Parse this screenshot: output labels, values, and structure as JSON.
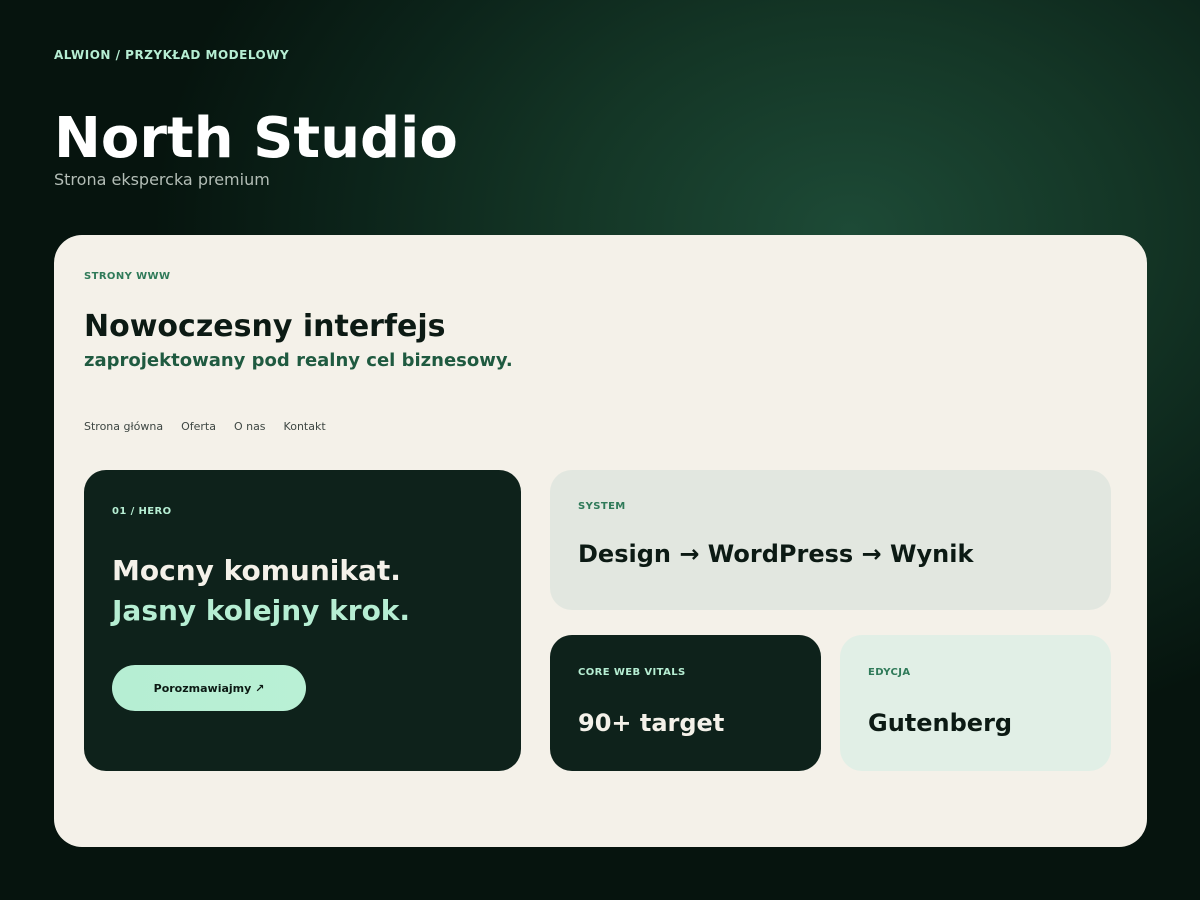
{
  "header": {
    "breadcrumb": "ALWION / PRZYKŁAD MODELOWY",
    "title": "North Studio",
    "subtitle": "Strona ekspercka premium"
  },
  "card": {
    "eyebrow": "STRONY WWW",
    "headline": "Nowoczesny interfejs",
    "subheadline": "zaprojektowany pod realny cel biznesowy.",
    "nav": [
      "Strona główna",
      "Oferta",
      "O nas",
      "Kontakt"
    ]
  },
  "hero": {
    "label": "01 / HERO",
    "line1": "Mocny komunikat.",
    "line2": "Jasny kolejny krok.",
    "cta_label": "Porozmawiajmy ↗"
  },
  "system": {
    "label": "SYSTEM",
    "text": "Design → WordPress → Wynik"
  },
  "core_web_vitals": {
    "label": "CORE WEB VITALS",
    "text": "90+ target"
  },
  "edition": {
    "label": "EDYCJA",
    "text": "Gutenberg"
  },
  "colors": {
    "accent_mint": "#b6eed3",
    "dark_green": "#0e221b",
    "brand_green": "#2f7a59",
    "card_bg": "#f4f1e9"
  }
}
